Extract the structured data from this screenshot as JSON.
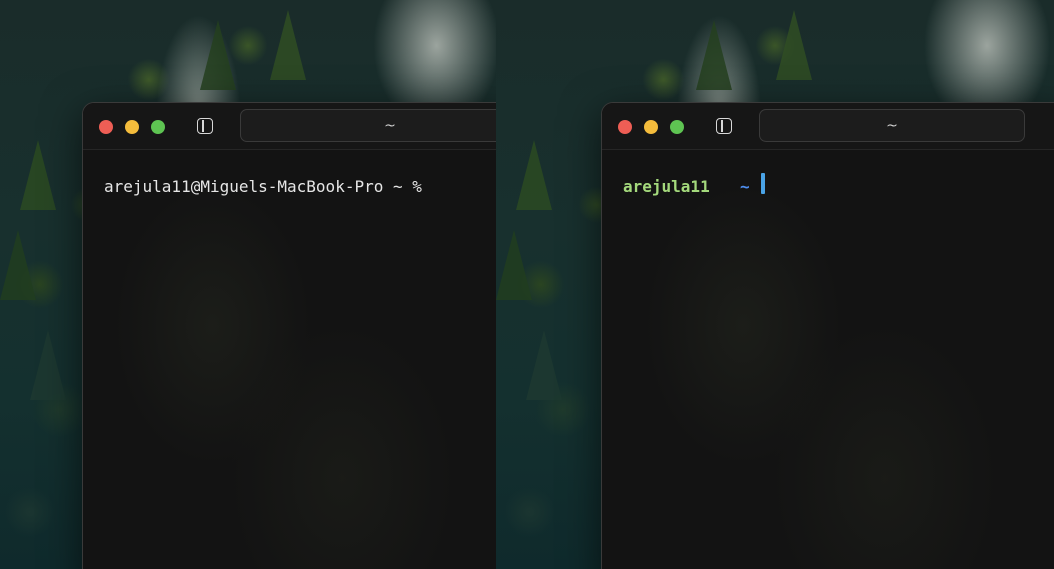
{
  "left_window": {
    "tab_title": "~",
    "prompt": "arejula11@Miguels-MacBook-Pro ~ %"
  },
  "right_window": {
    "tab_title": "~",
    "prompt_user": "arejula11",
    "prompt_dir": "~",
    "new_tab_label": "+"
  },
  "colors": {
    "close": "#ee5e55",
    "minimize": "#f4bc3c",
    "maximize": "#5ec452",
    "prompt_user": "#a4d97c",
    "prompt_dir": "#4f8ff0",
    "cursor": "#4aa3e6"
  },
  "icons": [
    "sidebar-toggle-icon",
    "plus-icon"
  ]
}
